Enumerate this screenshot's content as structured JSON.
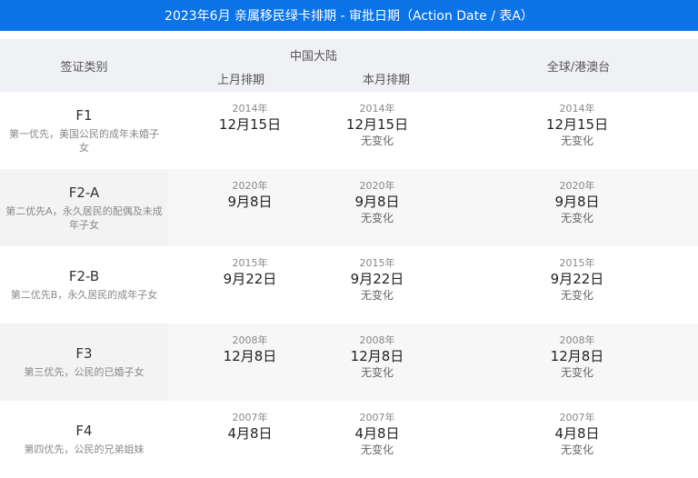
{
  "title": "2023年6月 亲属移民绿卡排期 - 审批日期（Action Date / 表A）",
  "header": {
    "category": "签证类别",
    "china": "中国大陆",
    "prev_month": "上月排期",
    "cur_month": "本月排期",
    "global": "全球/港澳台"
  },
  "rows": [
    {
      "code": "F1",
      "desc": "第一优先，美国公民的成年未婚子女",
      "prev": {
        "year": "2014年",
        "md": "12月15日"
      },
      "cur": {
        "year": "2014年",
        "md": "12月15日",
        "change": "无变化"
      },
      "global": {
        "year": "2014年",
        "md": "12月15日",
        "change": "无变化"
      }
    },
    {
      "code": "F2-A",
      "desc": "第二优先A，永久居民的配偶及未成年子女",
      "prev": {
        "year": "2020年",
        "md": "9月8日"
      },
      "cur": {
        "year": "2020年",
        "md": "9月8日",
        "change": "无变化"
      },
      "global": {
        "year": "2020年",
        "md": "9月8日",
        "change": "无变化"
      }
    },
    {
      "code": "F2-B",
      "desc": "第二优先B，永久居民的成年子女",
      "prev": {
        "year": "2015年",
        "md": "9月22日"
      },
      "cur": {
        "year": "2015年",
        "md": "9月22日",
        "change": "无变化"
      },
      "global": {
        "year": "2015年",
        "md": "9月22日",
        "change": "无变化"
      }
    },
    {
      "code": "F3",
      "desc": "第三优先，公民的已婚子女",
      "prev": {
        "year": "2008年",
        "md": "12月8日"
      },
      "cur": {
        "year": "2008年",
        "md": "12月8日",
        "change": "无变化"
      },
      "global": {
        "year": "2008年",
        "md": "12月8日",
        "change": "无变化"
      }
    },
    {
      "code": "F4",
      "desc": "第四优先，公民的兄弟姐妹",
      "prev": {
        "year": "2007年",
        "md": "4月8日"
      },
      "cur": {
        "year": "2007年",
        "md": "4月8日",
        "change": "无变化"
      },
      "global": {
        "year": "2007年",
        "md": "4月8日",
        "change": "无变化"
      }
    }
  ]
}
